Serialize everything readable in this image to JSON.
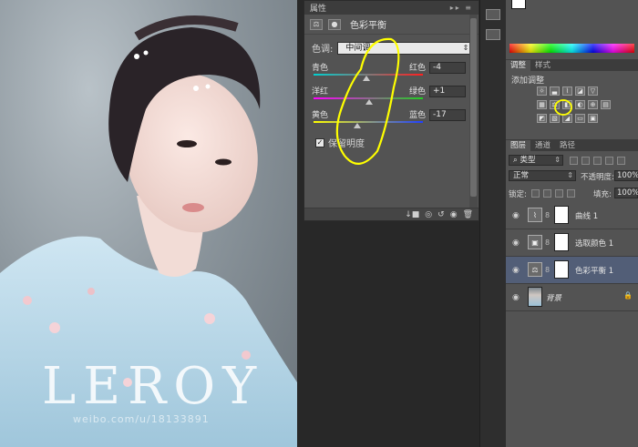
{
  "properties": {
    "tab": "属性",
    "title": "色彩平衡",
    "tone_label": "色调:",
    "tone_value": "中间调",
    "sliders": [
      {
        "left": "青色",
        "right": "红色",
        "value": "-4",
        "pos": 0.48,
        "gradient": [
          "#00d0d0",
          "#ff2020"
        ]
      },
      {
        "left": "洋红",
        "right": "绿色",
        "value": "+1",
        "pos": 0.51,
        "gradient": [
          "#ff00ff",
          "#20d020"
        ]
      },
      {
        "left": "黄色",
        "right": "蓝色",
        "value": "-17",
        "pos": 0.4,
        "gradient": [
          "#ffff00",
          "#2040ff"
        ]
      }
    ],
    "preserve_label": "保留明度",
    "preserve_checked": "✓"
  },
  "right_panel": {
    "adjust_tabs": [
      "调整",
      "样式"
    ],
    "adjust_title": "添加调整",
    "layer_tabs": [
      "图层",
      "通道",
      "路径"
    ],
    "filter_label": "类型",
    "blend_mode": "正常",
    "opacity_label": "不透明度:",
    "opacity_value": "100%",
    "lock_label": "锁定:",
    "fill_label": "填充:",
    "fill_value": "100%",
    "layers": [
      {
        "name": "曲线 1",
        "icon": "⌇"
      },
      {
        "name": "选取颜色 1",
        "icon": "▣"
      },
      {
        "name": "色彩平衡 1",
        "icon": "⚖"
      }
    ],
    "background_layer": "背景"
  },
  "watermark": {
    "text": "LEROY",
    "sub": "weibo.com/u/18133891"
  },
  "colors": {
    "annotation": "#ffff00",
    "selected_layer": "#525e77"
  }
}
